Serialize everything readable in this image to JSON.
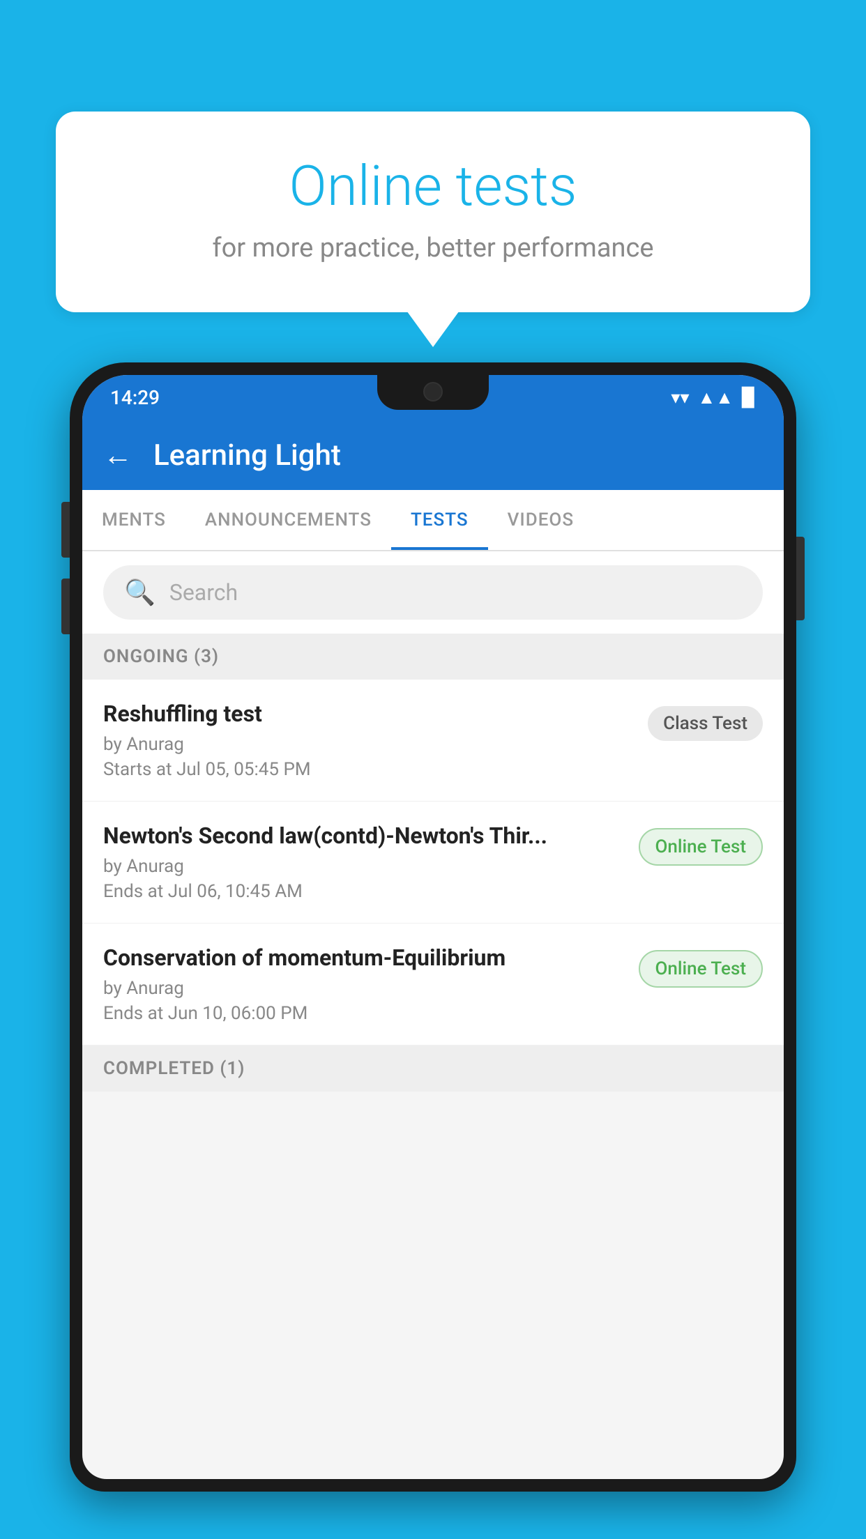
{
  "background": {
    "color": "#1ab3e8"
  },
  "speech_bubble": {
    "title": "Online tests",
    "subtitle": "for more practice, better performance"
  },
  "phone": {
    "status_bar": {
      "time": "14:29",
      "wifi": "▼",
      "signal": "▲",
      "battery": "▉"
    },
    "header": {
      "back_label": "←",
      "title": "Learning Light"
    },
    "tabs": [
      {
        "label": "MENTS",
        "active": false
      },
      {
        "label": "ANNOUNCEMENTS",
        "active": false
      },
      {
        "label": "TESTS",
        "active": true
      },
      {
        "label": "VIDEOS",
        "active": false
      }
    ],
    "search": {
      "placeholder": "Search"
    },
    "sections": [
      {
        "title": "ONGOING (3)",
        "items": [
          {
            "name": "Reshuffling test",
            "by": "by Anurag",
            "date": "Starts at  Jul 05, 05:45 PM",
            "badge": "Class Test",
            "badge_type": "class"
          },
          {
            "name": "Newton's Second law(contd)-Newton's Thir...",
            "by": "by Anurag",
            "date": "Ends at  Jul 06, 10:45 AM",
            "badge": "Online Test",
            "badge_type": "online"
          },
          {
            "name": "Conservation of momentum-Equilibrium",
            "by": "by Anurag",
            "date": "Ends at  Jun 10, 06:00 PM",
            "badge": "Online Test",
            "badge_type": "online"
          }
        ]
      }
    ],
    "bottom_section": {
      "title": "COMPLETED (1)"
    }
  }
}
